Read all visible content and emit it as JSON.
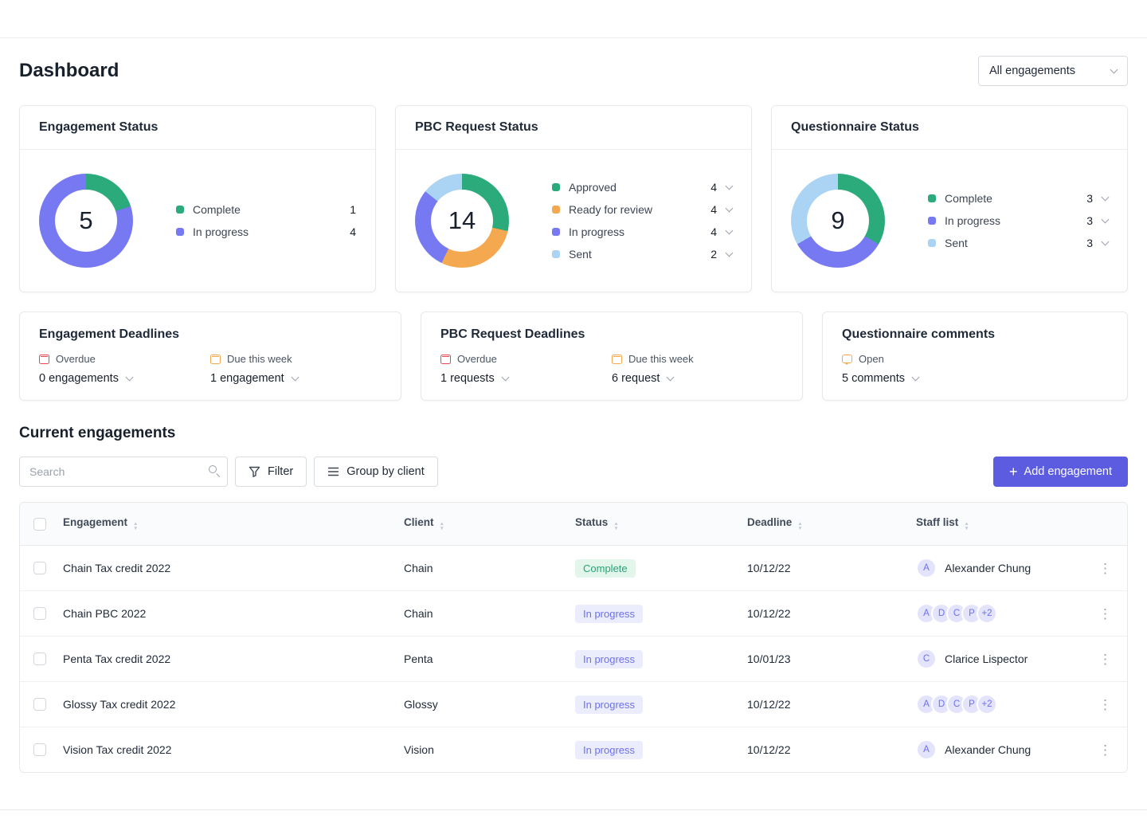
{
  "colors": {
    "accent": "#5b5ce0"
  },
  "page": {
    "title": "Dashboard",
    "engagement_filter": "All engagements"
  },
  "status_cards": [
    {
      "title": "Engagement Status",
      "total": "5",
      "show_chevrons": false,
      "segments": [
        {
          "label": "Complete",
          "value": 1,
          "color": "#2bab7c"
        },
        {
          "label": "In progress",
          "value": 4,
          "color": "#7679f2"
        }
      ]
    },
    {
      "title": "PBC Request Status",
      "total": "14",
      "show_chevrons": true,
      "segments": [
        {
          "label": "Approved",
          "value": 4,
          "color": "#2bab7c"
        },
        {
          "label": "Ready for review",
          "value": 4,
          "color": "#f4a951"
        },
        {
          "label": "In progress",
          "value": 4,
          "color": "#7679f2"
        },
        {
          "label": "Sent",
          "value": 2,
          "color": "#abd4f4"
        }
      ]
    },
    {
      "title": "Questionnaire Status",
      "total": "9",
      "show_chevrons": true,
      "segments": [
        {
          "label": "Complete",
          "value": 3,
          "color": "#2bab7c"
        },
        {
          "label": "In progress",
          "value": 3,
          "color": "#7679f2"
        },
        {
          "label": "Sent",
          "value": 3,
          "color": "#abd4f4"
        }
      ]
    }
  ],
  "deadline_cards": [
    {
      "title": "Engagement Deadlines",
      "items": [
        {
          "icon": "calendar",
          "icon_color": "#e5484d",
          "label": "Overdue",
          "value": "0 engagements"
        },
        {
          "icon": "calendar",
          "icon_color": "#f4a951",
          "label": "Due this week",
          "value": "1 engagement"
        }
      ]
    },
    {
      "title": "PBC Request Deadlines",
      "items": [
        {
          "icon": "calendar",
          "icon_color": "#e5484d",
          "label": "Overdue",
          "value": "1 requests"
        },
        {
          "icon": "calendar",
          "icon_color": "#f4a951",
          "label": "Due this week",
          "value": "6 request"
        }
      ]
    },
    {
      "title": "Questionnaire comments",
      "items": [
        {
          "icon": "comment",
          "icon_color": "#f4a951",
          "label": "Open",
          "value": "5 comments"
        }
      ]
    }
  ],
  "engagements": {
    "title": "Current engagements",
    "search_placeholder": "Search",
    "filter_label": "Filter",
    "group_label": "Group by client",
    "add_label": "Add engagement",
    "columns": [
      "Engagement",
      "Client",
      "Status",
      "Deadline",
      "Staff list"
    ],
    "rows": [
      {
        "name": "Chain Tax credit 2022",
        "client": "Chain",
        "status": "Complete",
        "status_kind": "complete",
        "deadline": "10/12/22",
        "avatars": [
          "A"
        ],
        "staff_name": "Alexander Chung"
      },
      {
        "name": "Chain PBC 2022",
        "client": "Chain",
        "status": "In progress",
        "status_kind": "in-progress",
        "deadline": "10/12/22",
        "avatars": [
          "A",
          "D",
          "C",
          "P",
          "+2"
        ],
        "staff_name": ""
      },
      {
        "name": "Penta Tax credit 2022",
        "client": "Penta",
        "status": "In progress",
        "status_kind": "in-progress",
        "deadline": "10/01/23",
        "avatars": [
          "C"
        ],
        "staff_name": "Clarice Lispector"
      },
      {
        "name": "Glossy Tax credit 2022",
        "client": "Glossy",
        "status": "In progress",
        "status_kind": "in-progress",
        "deadline": "10/12/22",
        "avatars": [
          "A",
          "D",
          "C",
          "P",
          "+2"
        ],
        "staff_name": ""
      },
      {
        "name": "Vision Tax credit 2022",
        "client": "Vision",
        "status": "In progress",
        "status_kind": "in-progress",
        "deadline": "10/12/22",
        "avatars": [
          "A"
        ],
        "staff_name": "Alexander Chung"
      }
    ]
  }
}
